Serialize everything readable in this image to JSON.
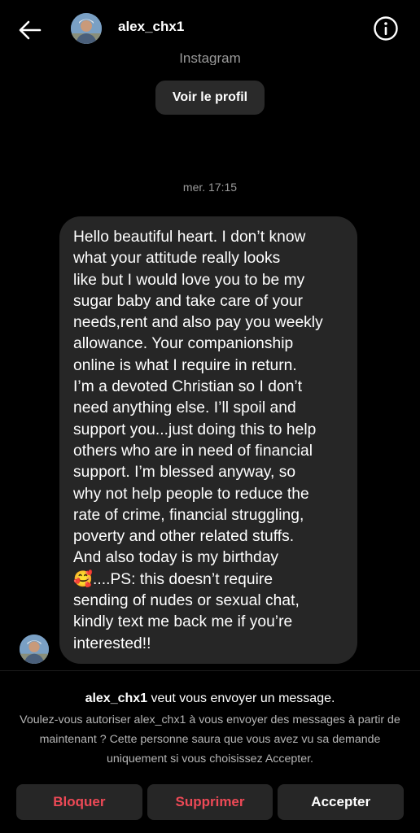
{
  "header": {
    "username": "alex_chx1",
    "back_icon": "arrow-left-icon",
    "info_icon": "info-circle-icon"
  },
  "thread": {
    "cut_off_text": "Instagram",
    "view_profile_label": "Voir le profil",
    "timestamp": "mer. 17:15",
    "message": "Hello beautiful heart. I don’t know\nwhat your attitude really looks\nlike but I would love you to be my\nsugar baby and take care of your\nneeds,rent and also pay you weekly\nallowance. Your companionship\nonline is what I require in return.\nI’m a devoted Christian so I don’t\nneed anything else. I’ll spoil and\nsupport you...just doing this to help\nothers who are in need of financial\nsupport. I’m blessed anyway, so\nwhy not help people to reduce the\nrate of crime, financial struggling,\npoverty and other related stuffs.\nAnd also today is my birthday\n🥰....PS: this doesn’t require\nsending of nudes or sexual chat,\nkindly text me back me if you’re\ninterested!!"
  },
  "request": {
    "title_user": "alex_chx1",
    "title_rest": " veut vous envoyer un message.",
    "description": "Voulez-vous autoriser alex_chx1 à vous envoyer des messages à partir de maintenant ? Cette personne saura que vous avez vu sa demande uniquement si vous choisissez Accepter.",
    "block_label": "Bloquer",
    "delete_label": "Supprimer",
    "accept_label": "Accepter"
  },
  "colors": {
    "background": "#000000",
    "bubble": "#262626",
    "danger": "#ed4956",
    "muted": "#9a9a9a"
  }
}
